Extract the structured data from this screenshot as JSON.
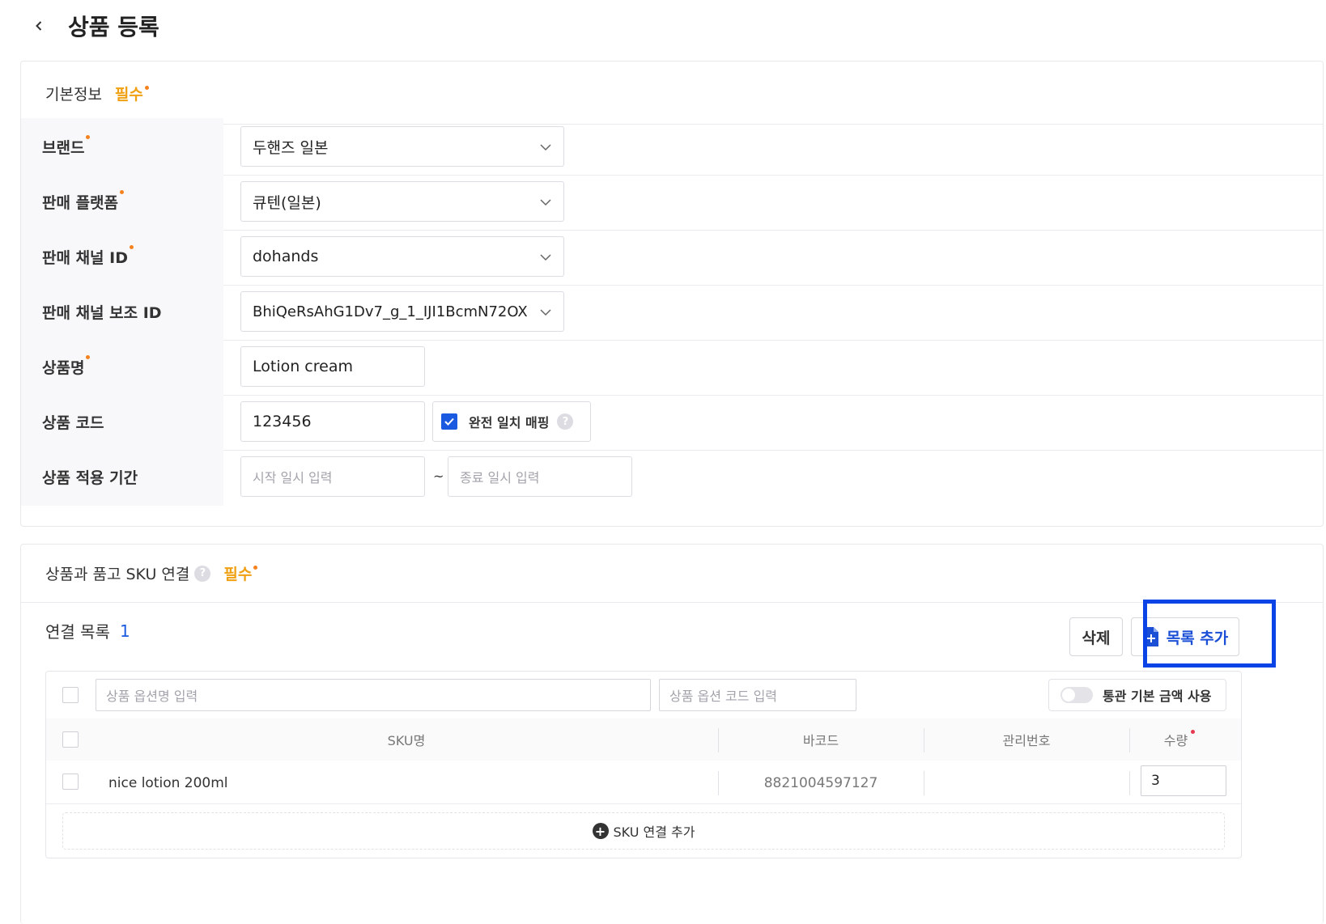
{
  "header": {
    "title": "상품 등록"
  },
  "basic_info": {
    "title": "기본정보",
    "required_label": "필수",
    "rows": [
      {
        "label": "브랜드",
        "required": true,
        "value": "두핸즈 일본"
      },
      {
        "label": "판매 플랫폼",
        "required": true,
        "value": "큐텐(일본)"
      },
      {
        "label": "판매 채널 ID",
        "required": true,
        "value": "dohands"
      },
      {
        "label": "판매 채널 보조 ID",
        "required": false,
        "value": "BhiQeRsAhG1Dv7_g_1_IJI1BcmN72OX"
      },
      {
        "label": "상품명",
        "required": true,
        "value": "Lotion cream"
      },
      {
        "label": "상품 코드",
        "required": false,
        "value": "123456"
      },
      {
        "label": "상품 적용 기간",
        "required": false
      }
    ],
    "exact_match_label": "완전 일치 매핑",
    "start_placeholder": "시작 일시 입력",
    "end_placeholder": "종료 일시 입력",
    "range_separator": "~"
  },
  "sku_section": {
    "title": "상품과 품고 SKU 연결",
    "required_label": "필수",
    "list_label": "연결 목록",
    "list_count": "1",
    "delete_label": "삭제",
    "add_list_label": "목록 추가",
    "option_name_placeholder": "상품 옵션명 입력",
    "option_code_placeholder": "상품 옵션 코드 입력",
    "customs_toggle_label": "통관 기본 금액 사용",
    "columns": {
      "sku": "SKU명",
      "barcode": "바코드",
      "manage_no": "관리번호",
      "qty": "수량"
    },
    "rows": [
      {
        "sku": "nice lotion 200ml",
        "barcode": "8821004597127",
        "manage_no": "",
        "qty": "3"
      }
    ],
    "add_sku_label": "SKU 연결 추가"
  },
  "colors": {
    "accent_blue": "#1a5ae0",
    "required_orange": "#f0a013",
    "highlight": "#0a44e6"
  }
}
